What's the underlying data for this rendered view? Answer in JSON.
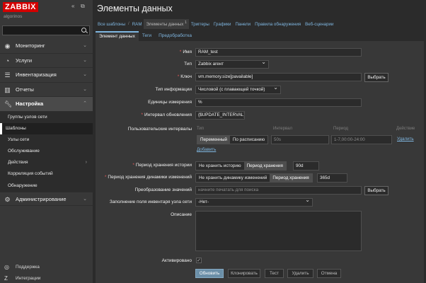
{
  "sidebar": {
    "logo": "ZABBIX",
    "collapse_icon": "«",
    "kiosk_icon": "⧉",
    "hostname": "algorinos",
    "search_placeholder": "",
    "menu": [
      {
        "label": "Мониторинг",
        "icon": "eye-icon"
      },
      {
        "label": "Услуги",
        "icon": "services-icon"
      },
      {
        "label": "Инвентаризация",
        "icon": "list-icon"
      },
      {
        "label": "Отчеты",
        "icon": "chart-icon"
      },
      {
        "label": "Настройка",
        "icon": "wrench-icon"
      }
    ],
    "submenu": [
      "Группы узлов сети",
      "Шаблоны",
      "Узлы сети",
      "Обслуживание",
      "Действия",
      "Корреляция событий",
      "Обнаружение"
    ],
    "admin": {
      "label": "Администрирование",
      "icon": "gear-icon"
    },
    "bottom": [
      {
        "label": "Поддержка",
        "icon": "support-icon"
      },
      {
        "label": "Интеграции",
        "icon": "integrations-icon"
      }
    ]
  },
  "header": {
    "title": "Элементы данных"
  },
  "breadcrumbs": {
    "all_templates": "Все шаблоны",
    "template": "RAM",
    "items": "Элементы данных",
    "items_count": "1",
    "triggers": "Триггеры",
    "graphs": "Графики",
    "dashboards": "Панели",
    "discovery": "Правила обнаружения",
    "web": "Веб-сценарии"
  },
  "tabs": [
    "Элемент данных",
    "Теги",
    "Предобработка"
  ],
  "form": {
    "name_label": "Имя",
    "name_value": "RAM_test",
    "type_label": "Тип",
    "type_value": "Zabbix агент",
    "key_label": "Ключ",
    "key_value": "vm.memory.size[pavailable]",
    "select_label": "Выбрать",
    "info_type_label": "Тип информации",
    "info_type_value": "Числовой (с плавающей точкой)",
    "units_label": "Единицы измерения",
    "units_value": "%",
    "interval_label": "Интервал обновления",
    "interval_value": "{$UPDATE_INTERVAL}",
    "custom_intervals_label": "Пользовательские интервалы",
    "custom_intervals": {
      "col_type": "Тип",
      "col_interval": "Интервал",
      "col_period": "Период",
      "col_action": "Действие",
      "type_flexible": "Переменный",
      "type_scheduling": "По расписанию",
      "interval_value": "50s",
      "period_value": "1-7,00:00-24:00",
      "remove": "Удалить",
      "add": "Добавить"
    },
    "history_label": "Период хранения истории",
    "history_no": "Не хранить историю",
    "history_yes": "Период хранения",
    "history_value": "90d",
    "trends_label": "Период хранения динамики изменений",
    "trends_no": "Не хранить динамику изменений",
    "trends_yes": "Период хранения",
    "trends_value": "365d",
    "valuemap_label": "Преобразование значений",
    "valuemap_placeholder": "начните печатать для поиска",
    "inventory_label": "Заполнение поля инвентаря узла сети",
    "inventory_value": "-Нет-",
    "description_label": "Описание",
    "enabled_label": "Активировано",
    "enabled_mark": "✓"
  },
  "buttons": {
    "update": "Обновить",
    "clone": "Клонировать",
    "test": "Тест",
    "delete": "Удалить",
    "cancel": "Отмена"
  },
  "colors": {
    "accent": "#d40000",
    "link": "#7fb6e0",
    "primary_button": "#6b8fa8"
  }
}
